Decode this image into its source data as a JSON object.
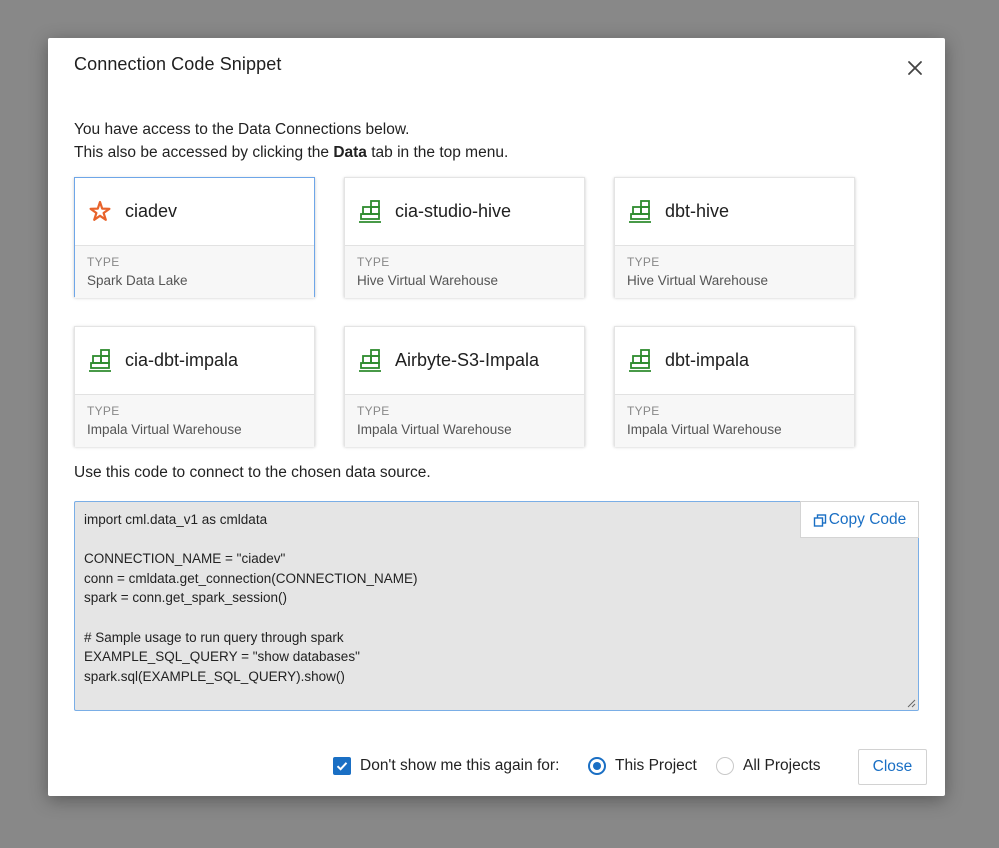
{
  "modal": {
    "title": "Connection Code Snippet",
    "intro_line1": "You have access to the Data Connections below.",
    "intro_line2_before": "This also be accessed by clicking the ",
    "intro_line2_bold": "Data",
    "intro_line2_after": " tab in the top menu.",
    "use_text": "Use this code to connect to the chosen data source."
  },
  "connections": [
    {
      "name": "ciadev",
      "type_label": "TYPE",
      "type": "Spark Data Lake",
      "icon": "spark-icon",
      "selected": true
    },
    {
      "name": "cia-studio-hive",
      "type_label": "TYPE",
      "type": "Hive Virtual Warehouse",
      "icon": "warehouse-icon",
      "selected": false
    },
    {
      "name": "dbt-hive",
      "type_label": "TYPE",
      "type": "Hive Virtual Warehouse",
      "icon": "warehouse-icon",
      "selected": false
    },
    {
      "name": "cia-dbt-impala",
      "type_label": "TYPE",
      "type": "Impala Virtual Warehouse",
      "icon": "warehouse-icon",
      "selected": false
    },
    {
      "name": "Airbyte-S3-Impala",
      "type_label": "TYPE",
      "type": "Impala Virtual Warehouse",
      "icon": "warehouse-icon",
      "selected": false
    },
    {
      "name": "dbt-impala",
      "type_label": "TYPE",
      "type": "Impala Virtual Warehouse",
      "icon": "warehouse-icon",
      "selected": false
    }
  ],
  "code": {
    "text": "import cml.data_v1 as cmldata\n\nCONNECTION_NAME = \"ciadev\"\nconn = cmldata.get_connection(CONNECTION_NAME)\nspark = conn.get_spark_session()\n\n# Sample usage to run query through spark\nEXAMPLE_SQL_QUERY = \"show databases\"\nspark.sql(EXAMPLE_SQL_QUERY).show()",
    "copy_label": "Copy Code"
  },
  "footer": {
    "dont_show_label": "Don't show me this again for:",
    "dont_show_checked": true,
    "radio_this_project": "This Project",
    "radio_all_projects": "All Projects",
    "selected_scope": "This Project",
    "close_label": "Close"
  },
  "colors": {
    "accent": "#1a6fc4",
    "spark_icon": "#e8632b",
    "warehouse_icon": "#2e8b2e",
    "overlay": "#888888",
    "code_bg": "#e5e5e5"
  }
}
